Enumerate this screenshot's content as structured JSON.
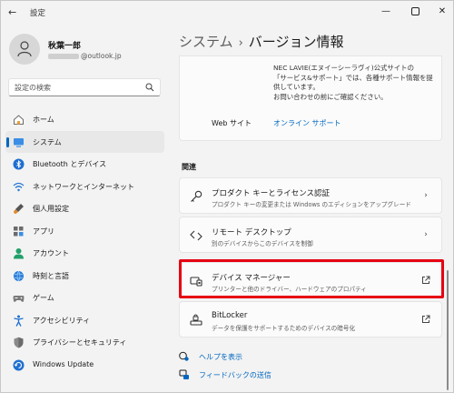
{
  "window": {
    "app_title": "設定",
    "back_icon": "back-arrow-icon",
    "controls": [
      "minimize-icon",
      "maximize-icon",
      "close-icon"
    ]
  },
  "user": {
    "name": "秋葉一郎",
    "email_suffix": "@outlook.jp"
  },
  "search": {
    "placeholder": "設定の検索"
  },
  "nav": {
    "items": [
      {
        "label": "ホーム",
        "icon": "home-icon"
      },
      {
        "label": "システム",
        "icon": "system-display-icon",
        "active": true
      },
      {
        "label": "Bluetooth とデバイス",
        "icon": "bluetooth-icon"
      },
      {
        "label": "ネットワークとインターネット",
        "icon": "wifi-icon"
      },
      {
        "label": "個人用設定",
        "icon": "brush-icon"
      },
      {
        "label": "アプリ",
        "icon": "apps-icon"
      },
      {
        "label": "アカウント",
        "icon": "account-icon"
      },
      {
        "label": "時刻と言語",
        "icon": "globe-clock-icon"
      },
      {
        "label": "ゲーム",
        "icon": "gamepad-icon"
      },
      {
        "label": "アクセシビリティ",
        "icon": "accessibility-icon"
      },
      {
        "label": "プライバシーとセキュリティ",
        "icon": "shield-icon"
      },
      {
        "label": "Windows Update",
        "icon": "update-icon"
      }
    ]
  },
  "header": {
    "crumb_parent": "システム",
    "crumb_sep": "›",
    "crumb_current": "バージョン情報"
  },
  "support": {
    "line1": "NEC LAVIE(エヌイーシーラヴィ)公式サイトの",
    "line2": "「サービス&サポート」では、各種サポート情報を提",
    "line3": "供しています。",
    "line4": "お問い合わせの前にご確認ください。",
    "website_label": "Web サイト",
    "website_link": "オンライン サポート"
  },
  "related": {
    "title": "関連",
    "rows": [
      {
        "title": "プロダクト キーとライセンス認証",
        "subtitle": "プロダクト キーの変更または Windows のエディションをアップグレード",
        "icon": "key-icon",
        "action": "chevron-right-icon"
      },
      {
        "title": "リモート デスクトップ",
        "subtitle": "別のデバイスからこのデバイスを制御",
        "icon": "remote-desktop-icon",
        "action": "chevron-right-icon"
      },
      {
        "title": "デバイス マネージャー",
        "subtitle": "プリンターと他のドライバー、ハードウェアのプロパティ",
        "icon": "device-manager-icon",
        "action": "open-external-icon"
      },
      {
        "title": "BitLocker",
        "subtitle": "データを保護をサポートするためのデバイスの暗号化",
        "icon": "bitlocker-icon",
        "action": "open-external-icon"
      }
    ]
  },
  "footer_links": [
    {
      "label": "ヘルプを表示",
      "icon": "help-icon"
    },
    {
      "label": "フィードバックの送信",
      "icon": "feedback-icon"
    }
  ],
  "colors": {
    "accent": "#0067c0",
    "highlight": "#e60012"
  }
}
